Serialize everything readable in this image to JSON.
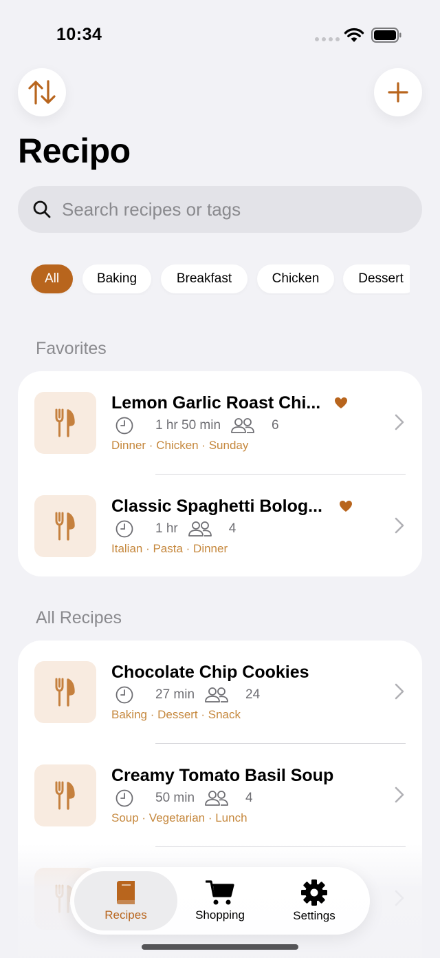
{
  "status_bar": {
    "time": "10:34"
  },
  "header": {
    "title": "Recipo"
  },
  "search": {
    "placeholder": "Search recipes or tags"
  },
  "filters": [
    "All",
    "Baking",
    "Breakfast",
    "Chicken",
    "Dessert"
  ],
  "sections": {
    "favorites": {
      "label": "Favorites",
      "items": [
        {
          "title": "Lemon Garlic Roast Chi...",
          "time": "1 hr 50 min",
          "servings": "6",
          "tags": "Dinner · Chicken · Sunday",
          "favorite": true
        },
        {
          "title": "Classic Spaghetti Bolog...",
          "time": "1 hr",
          "servings": "4",
          "tags": "Italian · Pasta · Dinner",
          "favorite": true
        }
      ]
    },
    "all_recipes": {
      "label": "All Recipes",
      "items": [
        {
          "title": "Chocolate Chip Cookies",
          "time": "27 min",
          "servings": "24",
          "tags": "Baking · Dessert · Snack"
        },
        {
          "title": "Creamy Tomato Basil Soup",
          "time": "50 min",
          "servings": "4",
          "tags": "Soup · Vegetarian · Lunch"
        }
      ]
    }
  },
  "tab_bar": {
    "recipes": "Recipes",
    "shopping": "Shopping",
    "settings": "Settings"
  },
  "colors": {
    "accent": "#b8651d",
    "tag_text": "#c5873c",
    "thumb_bg": "#f8ebe0",
    "background": "#f2f2f6"
  },
  "icons": {
    "sort": "arrow-up-down-icon",
    "add": "plus-icon",
    "search": "magnifier-icon",
    "thumb": "fork-knife-icon",
    "favorite": "heart-icon",
    "time": "clock-icon",
    "servings": "people-icon",
    "disclosure": "chevron-right-icon",
    "recipes_tab": "book-icon",
    "shopping_tab": "cart-icon",
    "settings_tab": "gear-icon"
  }
}
